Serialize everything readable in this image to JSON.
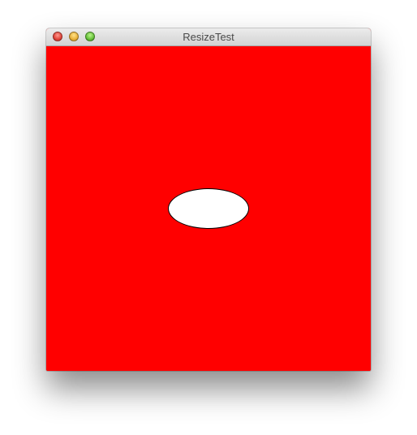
{
  "window": {
    "title": "ResizeTest"
  },
  "canvas": {
    "background_color": "#ff0000",
    "shape": "ellipse",
    "shape_fill": "#ffffff",
    "shape_stroke": "#000000"
  },
  "icons": {
    "close": "close-icon",
    "minimize": "minimize-icon",
    "maximize": "maximize-icon"
  }
}
